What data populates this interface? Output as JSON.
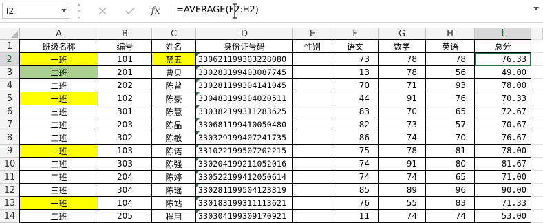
{
  "formula_bar": {
    "name_box": "I2",
    "cancel_icon": "close-icon",
    "enter_icon": "check-icon",
    "function_label": "fx",
    "formula": "=AVERAGE(F2:H2)"
  },
  "columns": [
    "A",
    "B",
    "C",
    "D",
    "E",
    "F",
    "G",
    "H",
    "I"
  ],
  "selected_column": "I",
  "row_numbers": [
    "1",
    "2",
    "3",
    "4",
    "5",
    "6",
    "7",
    "8",
    "9",
    "10",
    "11",
    "12",
    "13",
    "14"
  ],
  "selected_row": "2",
  "headers": [
    "班级名称",
    "编号",
    "姓名",
    "身份证号码",
    "性别",
    "语文",
    "数学",
    "英语",
    "总分"
  ],
  "rows": [
    [
      "一班",
      "101",
      "禁五",
      "330621199303228080",
      "",
      "73",
      "78",
      "78",
      "76.33"
    ],
    [
      "二班",
      "201",
      "曹贝",
      "330283199403087745",
      "",
      "13",
      "78",
      "56",
      "49.00"
    ],
    [
      "二班",
      "202",
      "陈曾",
      "330281199304141045",
      "",
      "70",
      "71",
      "93",
      "78.00"
    ],
    [
      "一班",
      "102",
      "陈豪",
      "330483199304020511",
      "",
      "44",
      "91",
      "76",
      "70.33"
    ],
    [
      "三班",
      "301",
      "陈慧",
      "330382199311283625",
      "",
      "83",
      "70",
      "65",
      "72.67"
    ],
    [
      "二班",
      "203",
      "陈晶",
      "330681199410050480",
      "",
      "82",
      "73",
      "57",
      "70.67"
    ],
    [
      "三班",
      "302",
      "陈敏",
      "330329199407241735",
      "",
      "86",
      "74",
      "70",
      "76.67"
    ],
    [
      "一班",
      "103",
      "陈诺",
      "331022199507202215",
      "",
      "75",
      "78",
      "81",
      "78.00"
    ],
    [
      "三班",
      "303",
      "陈强",
      "330204199211052016",
      "",
      "74",
      "91",
      "80",
      "81.67"
    ],
    [
      "二班",
      "204",
      "陈婷",
      "330522199412050614",
      "",
      "74",
      "74",
      "65",
      "71.00"
    ],
    [
      "三班",
      "304",
      "陈瑶",
      "330281199504123319",
      "",
      "85",
      "89",
      "96",
      "90.00"
    ],
    [
      "一班",
      "104",
      "陈站",
      "330183199311113621",
      "",
      "76",
      "55",
      "83",
      "71.33"
    ],
    [
      "二班",
      "205",
      "程用",
      "330304199309170921",
      "",
      "11",
      "74",
      "74",
      "53.00"
    ]
  ],
  "colors": {
    "yellow": "#ffff00",
    "green": "#a9d08e",
    "accent": "#217346"
  }
}
